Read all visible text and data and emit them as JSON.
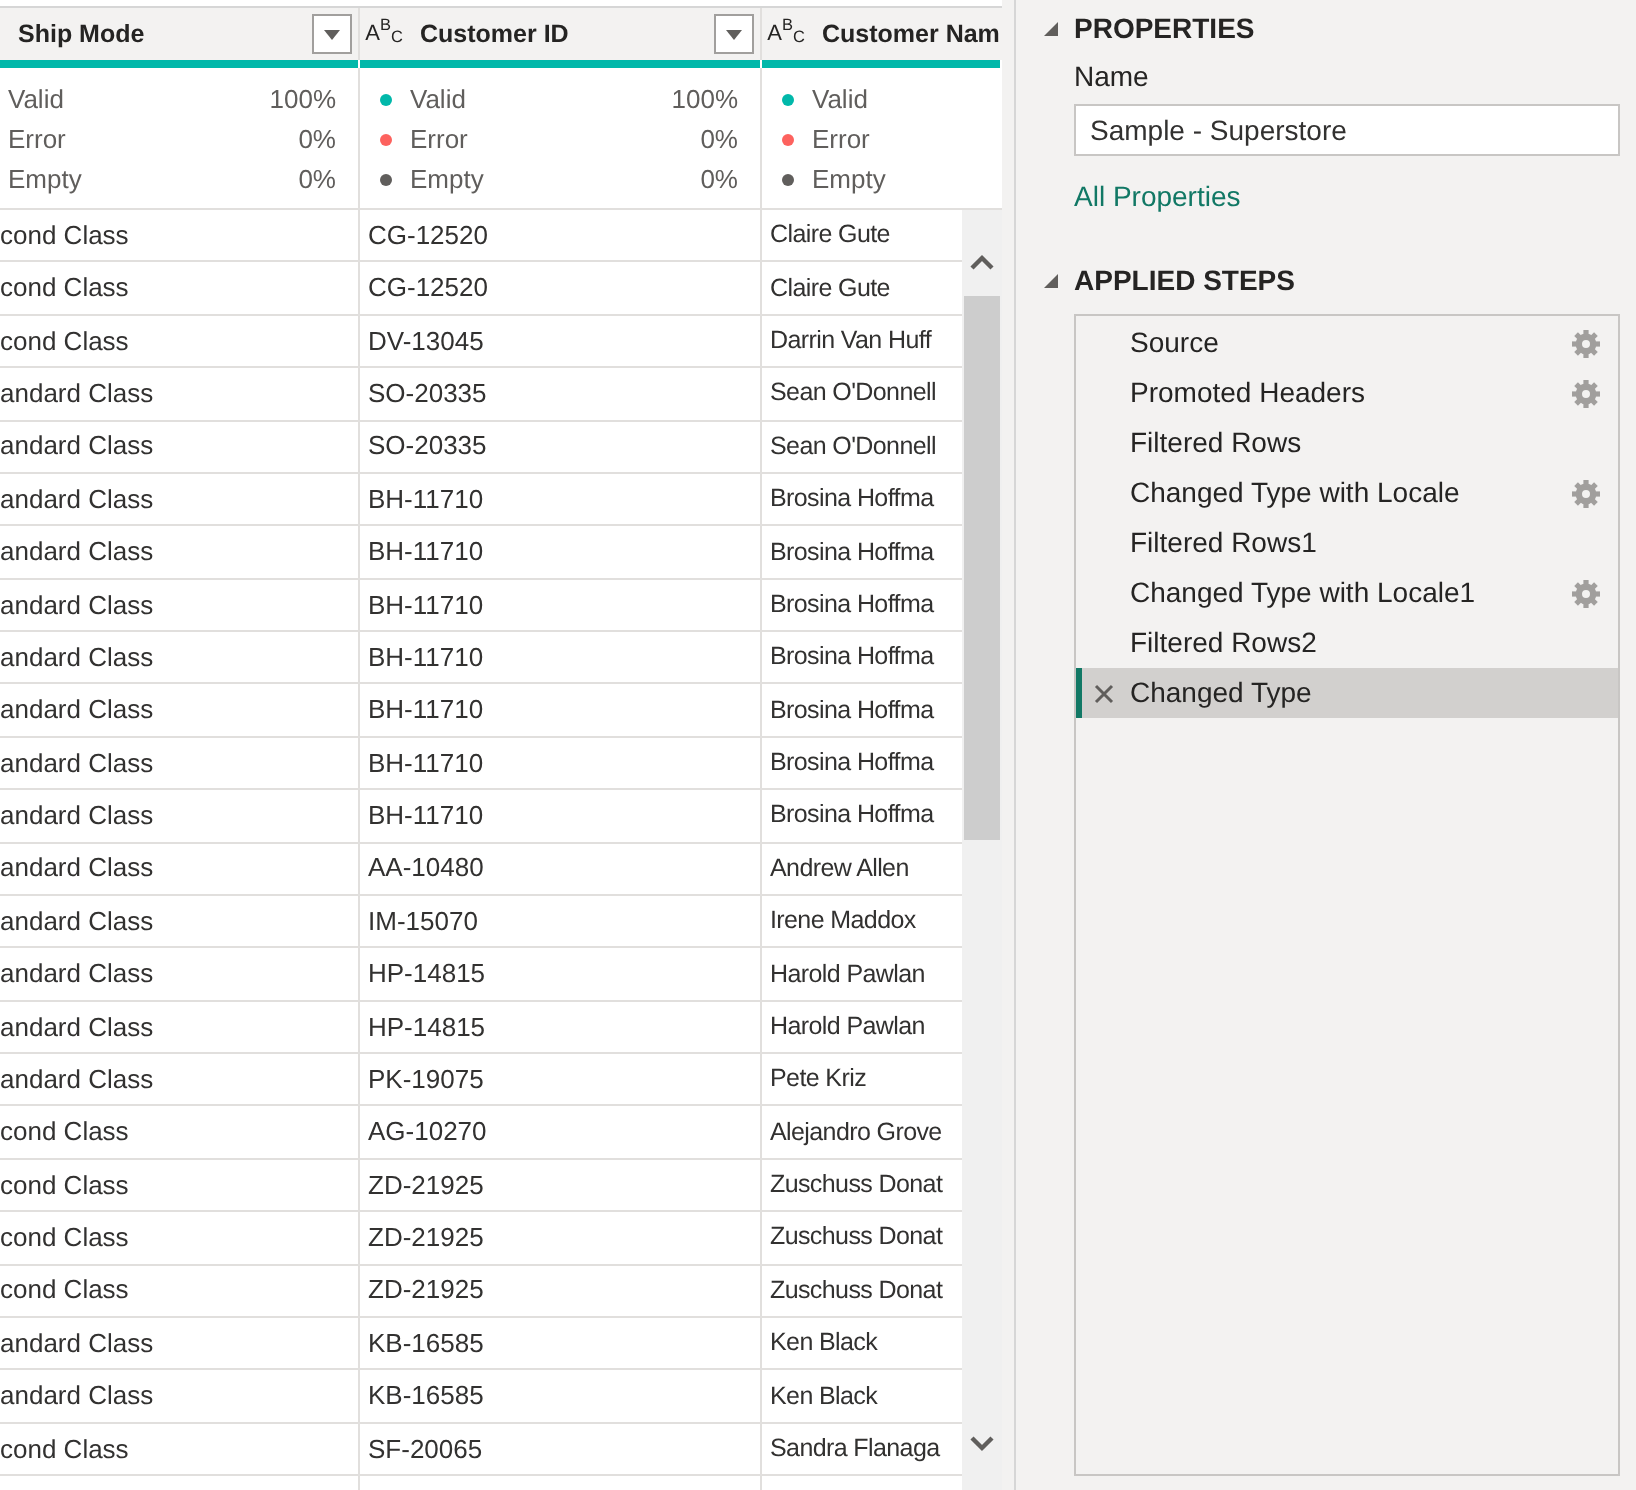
{
  "columns": [
    {
      "title": "Ship Mode",
      "filter_button": true,
      "level": 1,
      "stats": [
        {
          "label": "Valid",
          "value": "100%"
        },
        {
          "label": "Error",
          "value": "0%"
        },
        {
          "label": "Empty",
          "value": "0%"
        }
      ]
    },
    {
      "title": "Customer ID",
      "type_label": "A$^{B}$$_{C}$",
      "filter_button": true,
      "level": 1,
      "stats": [
        {
          "label": "Valid",
          "value": "100%",
          "color": "#01b8aa"
        },
        {
          "label": "Error",
          "value": "0%",
          "color": "#fd625e"
        },
        {
          "label": "Empty",
          "value": "0%",
          "color": "#605e5c"
        }
      ]
    },
    {
      "title": "Customer Nam",
      "type_label": "A$^{B}$$_{C}$",
      "level": 1,
      "stats": [
        {
          "label": "Valid",
          "color": "#01b8aa"
        },
        {
          "label": "Error",
          "color": "#fd625e"
        },
        {
          "label": "Empty",
          "color": "#605e5c"
        }
      ]
    }
  ],
  "rows": [
    [
      "cond Class",
      "CG-12520",
      "Claire Gute"
    ],
    [
      "cond Class",
      "CG-12520",
      "Claire Gute"
    ],
    [
      "cond Class",
      "DV-13045",
      "Darrin Van Huff"
    ],
    [
      "andard Class",
      "SO-20335",
      "Sean O'Donnell"
    ],
    [
      "andard Class",
      "SO-20335",
      "Sean O'Donnell"
    ],
    [
      "andard Class",
      "BH-11710",
      "Brosina Hoffma"
    ],
    [
      "andard Class",
      "BH-11710",
      "Brosina Hoffma"
    ],
    [
      "andard Class",
      "BH-11710",
      "Brosina Hoffma"
    ],
    [
      "andard Class",
      "BH-11710",
      "Brosina Hoffma"
    ],
    [
      "andard Class",
      "BH-11710",
      "Brosina Hoffma"
    ],
    [
      "andard Class",
      "BH-11710",
      "Brosina Hoffma"
    ],
    [
      "andard Class",
      "BH-11710",
      "Brosina Hoffma"
    ],
    [
      "andard Class",
      "AA-10480",
      "Andrew Allen"
    ],
    [
      "andard Class",
      "IM-15070",
      "Irene Maddox"
    ],
    [
      "andard Class",
      "HP-14815",
      "Harold Pawlan"
    ],
    [
      "andard Class",
      "HP-14815",
      "Harold Pawlan"
    ],
    [
      "andard Class",
      "PK-19075",
      "Pete Kriz"
    ],
    [
      "cond Class",
      "AG-10270",
      "Alejandro Grove"
    ],
    [
      "cond Class",
      "ZD-21925",
      "Zuschuss Donat"
    ],
    [
      "cond Class",
      "ZD-21925",
      "Zuschuss Donat"
    ],
    [
      "cond Class",
      "ZD-21925",
      "Zuschuss Donat"
    ],
    [
      "andard Class",
      "KB-16585",
      "Ken Black"
    ],
    [
      "andard Class",
      "KB-16585",
      "Ken Black"
    ],
    [
      "cond Class",
      "SF-20065",
      "Sandra Flanaga"
    ]
  ],
  "properties": {
    "title": "PROPERTIES",
    "name_label": "Name",
    "name_value": "Sample - Superstore",
    "link": "All Properties"
  },
  "applied_steps": {
    "title": "APPLIED STEPS",
    "steps": [
      {
        "label": "Source",
        "settings": true,
        "selected": false
      },
      {
        "label": "Promoted Headers",
        "settings": true,
        "selected": false
      },
      {
        "label": "Filtered Rows",
        "settings": false,
        "selected": false
      },
      {
        "label": "Changed Type with Locale",
        "settings": true,
        "selected": false
      },
      {
        "label": "Filtered Rows1",
        "settings": false,
        "selected": false
      },
      {
        "label": "Changed Type with Locale1",
        "settings": true,
        "selected": false
      },
      {
        "label": "Filtered Rows2",
        "settings": false,
        "selected": false
      },
      {
        "label": "Changed Type",
        "settings": false,
        "selected": true
      }
    ]
  }
}
